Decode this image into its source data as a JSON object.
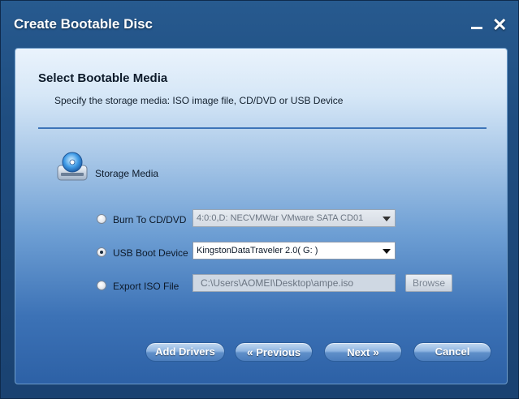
{
  "window": {
    "title": "Create Bootable Disc",
    "minimize_glyph": "",
    "close_glyph": "✕"
  },
  "header": {
    "title": "Select Bootable Media",
    "subtitle": "Specify the storage media: ISO image file, CD/DVD or USB Device"
  },
  "media": {
    "label": "Storage Media",
    "icon": "disc-drive-icon"
  },
  "options": {
    "burn": {
      "label": "Burn To CD/DVD",
      "selected": false,
      "value": "4:0:0,D: NECVMWar VMware SATA CD01",
      "enabled": false
    },
    "usb": {
      "label": "USB Boot Device",
      "selected": true,
      "value": "KingstonDataTraveler 2.0( G: )",
      "enabled": true
    },
    "iso": {
      "label": "Export ISO File",
      "selected": false,
      "value": "C:\\Users\\AOMEI\\Desktop\\ampe.iso",
      "browse_label": "Browse",
      "enabled": false
    }
  },
  "buttons": {
    "add_drivers": "Add Drivers",
    "previous_chev": "«",
    "previous": "Previous",
    "next": "Next",
    "next_chev": "»",
    "cancel": "Cancel"
  },
  "colors": {
    "title_bar": "#275a8f",
    "panel_top": "#eaf3fc",
    "panel_bottom": "#2d61a6",
    "divider": "#3d74b8",
    "button": "#5f8fc9"
  }
}
